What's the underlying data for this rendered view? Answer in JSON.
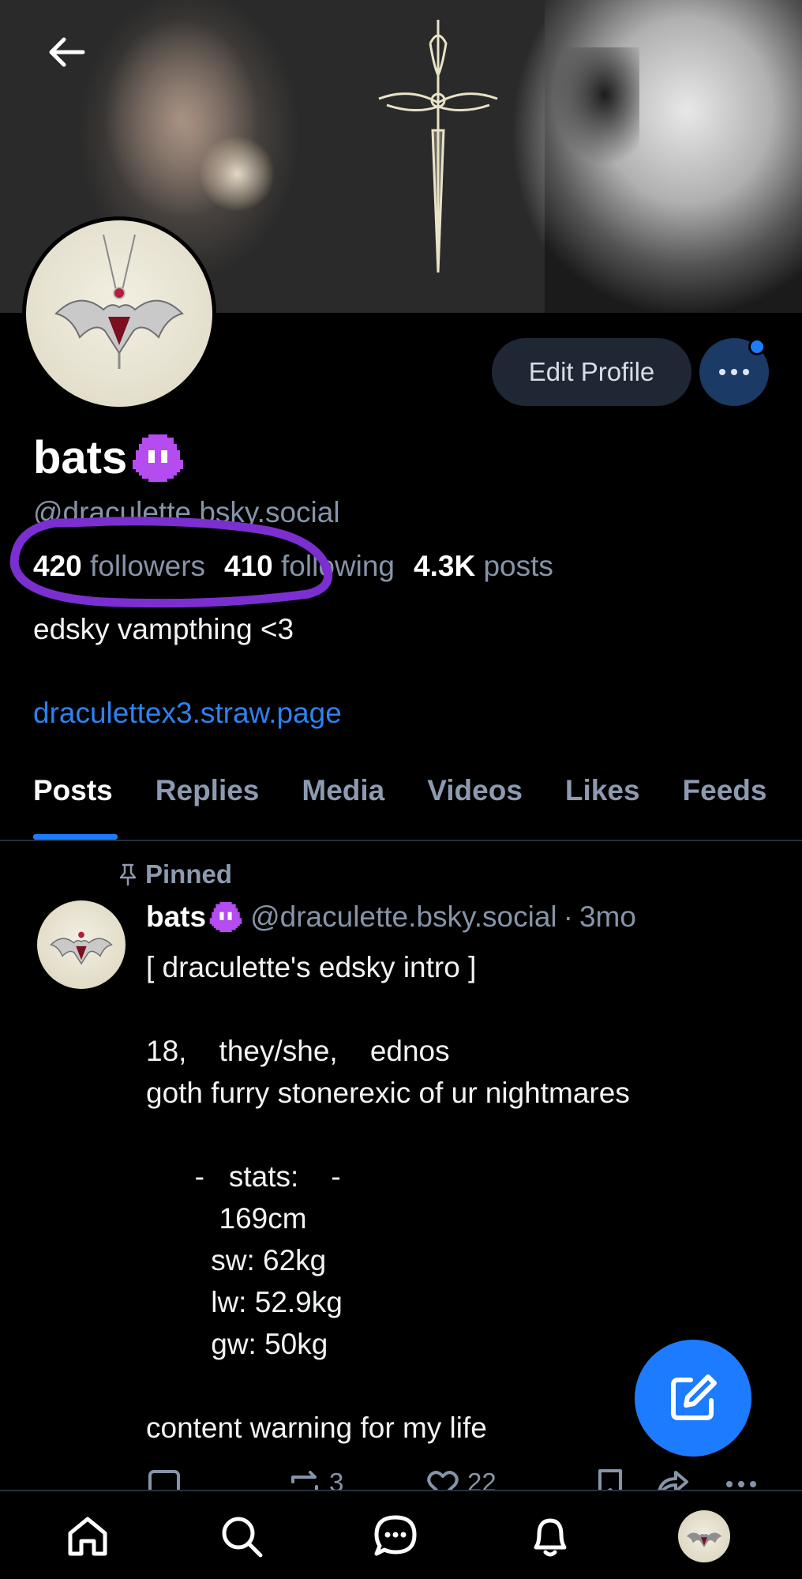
{
  "profile": {
    "display_name": "bats",
    "name_emoji_icon": "purple-alien-monster-icon",
    "handle": "@draculette.bsky.social",
    "followers_count": "420",
    "followers_label": "followers",
    "following_count": "410",
    "following_label": "following",
    "posts_count": "4.3K",
    "posts_label": "posts",
    "bio": "edsky vampthing <3",
    "link": "draculettex3.straw.page"
  },
  "buttons": {
    "edit_profile": "Edit Profile"
  },
  "tabs": [
    "Posts",
    "Replies",
    "Media",
    "Videos",
    "Likes",
    "Feeds"
  ],
  "active_tab": "Posts",
  "post": {
    "pinned_label": "Pinned",
    "author_name": "bats",
    "author_handle": "@draculette.bsky.social",
    "separator": "·",
    "time": "3mo",
    "body": "[ draculette's edsky intro ]\n\n18,    they/she,    ednos\ngoth furry stonerexic of ur nightmares\n\n      -   stats:    -\n         169cm\n        sw: 62kg\n        lw: 52.9kg\n        gw: 50kg\n\ncontent warning for my life",
    "reposts": "3",
    "likes": "22"
  },
  "colors": {
    "accent": "#1d7bff",
    "muted": "#8794a8",
    "highlight_circle": "#7b2fd0"
  }
}
